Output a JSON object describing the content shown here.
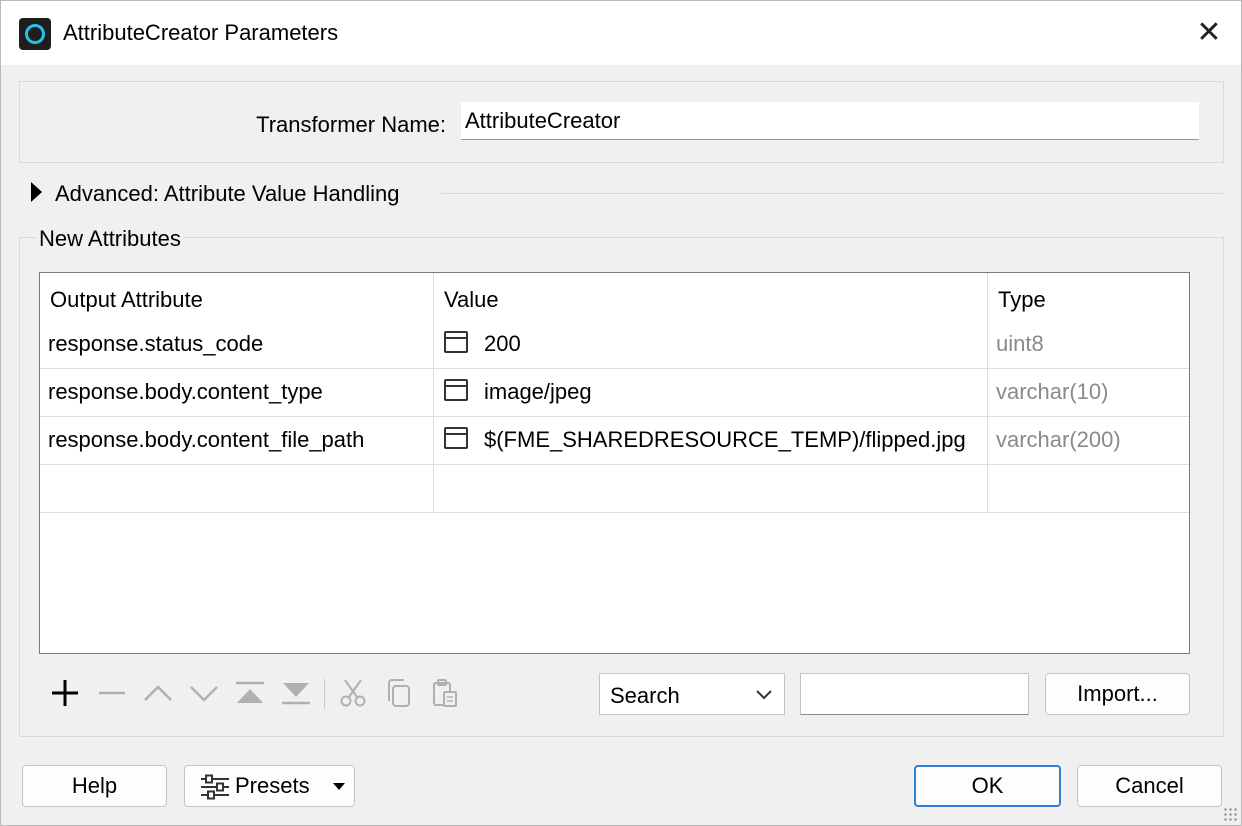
{
  "window": {
    "title": "AttributeCreator Parameters",
    "close_glyph": "✕"
  },
  "transformer_name": {
    "label": "Transformer Name:",
    "value": "AttributeCreator"
  },
  "advanced": {
    "label": "Advanced: Attribute Value Handling"
  },
  "new_attributes": {
    "group_title": "New Attributes",
    "columns": [
      "Output Attribute",
      "Value",
      "Type"
    ],
    "rows": [
      {
        "attribute": "response.status_code",
        "value": "200",
        "type": "uint8"
      },
      {
        "attribute": "response.body.content_type",
        "value": "image/jpeg",
        "type": "varchar(10)"
      },
      {
        "attribute": "response.body.content_file_path",
        "value": "$(FME_SHAREDRESOURCE_TEMP)/flipped.jpg",
        "type": "varchar(200)"
      }
    ]
  },
  "toolbar": {
    "search_label": "Search",
    "search_value": "",
    "import_label": "Import..."
  },
  "footer": {
    "help_label": "Help",
    "presets_label": "Presets",
    "ok_label": "OK",
    "cancel_label": "Cancel"
  },
  "colors": {
    "accent": "#2f7fd6",
    "app_icon": "#25c0e8",
    "type_text": "#8a8a8a"
  }
}
